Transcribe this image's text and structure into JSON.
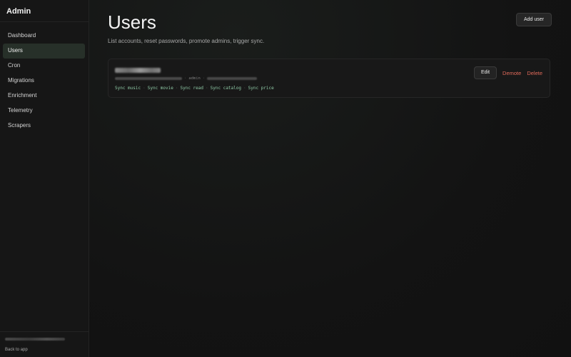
{
  "sidebar": {
    "title": "Admin",
    "items": [
      {
        "label": "Dashboard"
      },
      {
        "label": "Users"
      },
      {
        "label": "Cron"
      },
      {
        "label": "Migrations"
      },
      {
        "label": "Enrichment"
      },
      {
        "label": "Telemetry"
      },
      {
        "label": "Scrapers"
      }
    ],
    "active_index": 1,
    "footer": {
      "back_label": "Back to app"
    }
  },
  "main": {
    "title": "Users",
    "subtitle": "List accounts, reset passwords, promote admins, trigger sync.",
    "add_button_label": "Add user"
  },
  "users": [
    {
      "role": "admin",
      "separator": "·",
      "sync_actions": [
        "Sync music",
        "Sync movie",
        "Sync read",
        "Sync catalog",
        "Sync price"
      ],
      "actions": {
        "edit": "Edit",
        "demote": "Demote",
        "delete": "Delete"
      }
    }
  ],
  "colors": {
    "background": "#121212",
    "sidebar_active": "#273029",
    "sync_link": "#8fcaa6",
    "danger": "#e06a5a"
  }
}
